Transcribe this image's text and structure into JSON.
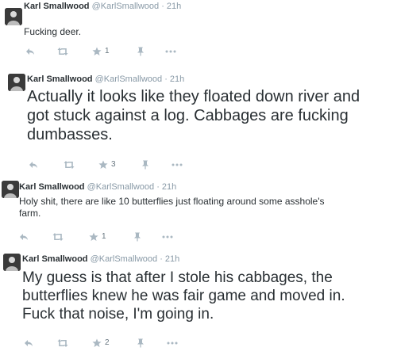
{
  "colors": {
    "name": "#292f33",
    "meta": "#8899a6",
    "action_icon": "#aab8c2",
    "divider": "#e8ecef"
  },
  "tweets": [
    {
      "name": "Karl Smallwood",
      "handle": "@KarlSmallwood",
      "separator": "·",
      "time": "21h",
      "text": "Fucking deer.",
      "favorites": "1"
    },
    {
      "name": "Karl Smallwood",
      "handle": "@KarlSmallwood",
      "separator": "·",
      "time": "21h",
      "text": "Actually it looks like they floated down river and got stuck against a log. Cabbages are fucking dumbasses.",
      "favorites": "3"
    },
    {
      "name": "Karl Smallwood",
      "handle": "@KarlSmallwood",
      "separator": "·",
      "time": "21h",
      "text": "Holy shit, there are like 10 butterflies just floating around some asshole's farm.",
      "favorites": "1"
    },
    {
      "name": "Karl Smallwood",
      "handle": "@KarlSmallwood",
      "separator": "·",
      "time": "21h",
      "text": "My guess is that after I stole his cabbages, the butterflies knew he was fair game and moved in. Fuck that noise, I'm going in.",
      "favorites": "2"
    }
  ],
  "icons": {
    "avatar": "avatar-photo",
    "reply": "reply-icon",
    "retweet": "retweet-icon",
    "favorite": "star-icon",
    "save": "pin-icon",
    "more": "more-icon"
  }
}
